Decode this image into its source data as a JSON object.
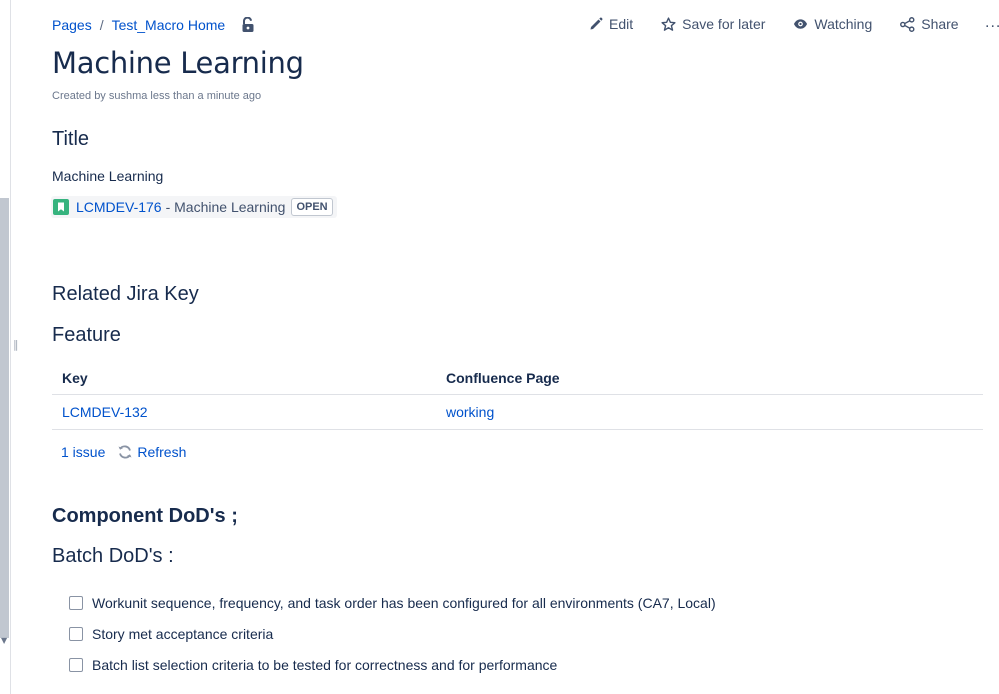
{
  "breadcrumb": {
    "items": [
      "Pages",
      "Test_Macro Home"
    ],
    "separator": "/"
  },
  "actions": {
    "edit": "Edit",
    "save_for_later": "Save for later",
    "watching": "Watching",
    "share": "Share",
    "more": "..."
  },
  "page": {
    "title": "Machine Learning",
    "byline": "Created by sushma less than a minute ago"
  },
  "content": {
    "title_heading": "Title",
    "title_text": "Machine Learning",
    "jira_issue": {
      "key": "LCMDEV-176",
      "summary": "- Machine Learning",
      "status": "OPEN",
      "status_color": "#42526e",
      "icon": "story-icon",
      "icon_color": "#36b37e"
    },
    "related_heading": "Related Jira Key",
    "feature_heading": "Feature",
    "table": {
      "columns": [
        "Key",
        "Confluence Page"
      ],
      "rows": [
        [
          "LCMDEV-132",
          "working"
        ]
      ],
      "issue_count": "1 issue",
      "refresh": "Refresh"
    },
    "component_heading": "Component DoD's ;",
    "batch_heading": "Batch DoD's :",
    "tasks": [
      "Workunit sequence, frequency, and task order has been configured for all environments (CA7, Local)",
      "Story met acceptance criteria",
      "Batch list selection criteria to be tested for correctness and for performance"
    ]
  },
  "colors": {
    "link": "#0052cc",
    "text": "#172b4d",
    "subtle": "#6b778c"
  }
}
